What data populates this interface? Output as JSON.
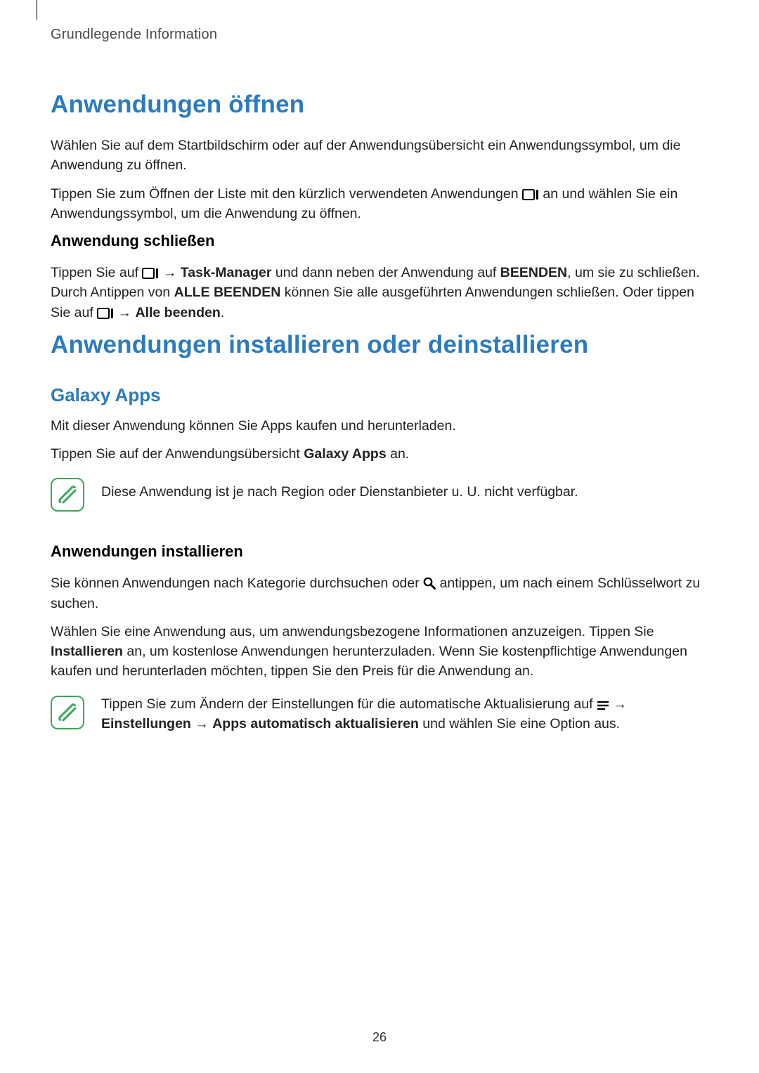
{
  "header": "Grundlegende Information",
  "pageNumber": "26",
  "s1": {
    "title": "Anwendungen öffnen",
    "p1": "Wählen Sie auf dem Startbildschirm oder auf der Anwendungsübersicht ein Anwendungssymbol, um die Anwendung zu öffnen.",
    "p2a": "Tippen Sie zum Öffnen der Liste mit den kürzlich verwendeten Anwendungen ",
    "p2b": " an und wählen Sie ein Anwendungssymbol, um die Anwendung zu öffnen.",
    "sub1": {
      "title": "Anwendung schließen",
      "p1a": "Tippen Sie auf ",
      "p1b": " → ",
      "p1c": "Task-Manager",
      "p1d": " und dann neben der Anwendung auf ",
      "p1e": "BEENDEN",
      "p1f": ", um sie zu schließen. Durch Antippen von ",
      "p1g": "ALLE BEENDEN",
      "p1h": " können Sie alle ausgeführten Anwendungen schließen. Oder tippen Sie auf ",
      "p1i": " → ",
      "p1j": "Alle beenden",
      "p1k": "."
    }
  },
  "s2": {
    "title": "Anwendungen installieren oder deinstallieren",
    "sub1": {
      "title": "Galaxy Apps",
      "p1": "Mit dieser Anwendung können Sie Apps kaufen und herunterladen.",
      "p2a": "Tippen Sie auf der Anwendungsübersicht ",
      "p2b": "Galaxy Apps",
      "p2c": " an.",
      "note": "Diese Anwendung ist je nach Region oder Dienstanbieter u. U. nicht verfügbar."
    },
    "sub2": {
      "title": "Anwendungen installieren",
      "p1a": "Sie können Anwendungen nach Kategorie durchsuchen oder ",
      "p1b": " antippen, um nach einem Schlüsselwort zu suchen.",
      "p2a": "Wählen Sie eine Anwendung aus, um anwendungsbezogene Informationen anzuzeigen. Tippen Sie ",
      "p2b": "Installieren",
      "p2c": " an, um kostenlose Anwendungen herunterzuladen. Wenn Sie kostenpflichtige Anwendungen kaufen und herunterladen möchten, tippen Sie den Preis für die Anwendung an.",
      "note_a": "Tippen Sie zum Ändern der Einstellungen für die automatische Aktualisierung auf ",
      "note_b": " → ",
      "note_c": "Einstellungen",
      "note_d": " → ",
      "note_e": "Apps automatisch aktualisieren",
      "note_f": " und wählen Sie eine Option aus."
    }
  }
}
